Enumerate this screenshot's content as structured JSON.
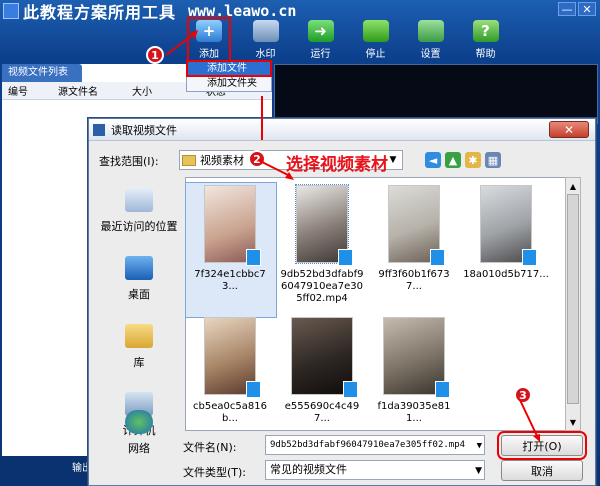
{
  "app": {
    "title": "此教程方案所用工具",
    "site": "www.leawo.cn",
    "window_buttons": [
      "—",
      "✕"
    ]
  },
  "toolbar": {
    "items": [
      {
        "label": "添加",
        "icon": "add-video-icon"
      },
      {
        "label": "水印",
        "icon": "watermark-icon"
      },
      {
        "label": "运行",
        "icon": "run-arrow-icon"
      },
      {
        "label": "停止",
        "icon": "stop-icon"
      },
      {
        "label": "设置",
        "icon": "settings-icon"
      },
      {
        "label": "帮助",
        "icon": "help-icon"
      }
    ]
  },
  "menu": {
    "items": [
      "添加文件",
      "添加文件夹"
    ]
  },
  "left_panel": {
    "tab": "视频文件列表",
    "columns": [
      "编号",
      "源文件名",
      "大小",
      "状态"
    ]
  },
  "bottom_bar": {
    "text": "输出"
  },
  "annotations": {
    "step1": "1",
    "step2": "2",
    "step3": "3",
    "step2_text": "选择视频素材"
  },
  "dialog": {
    "title": "读取视频文件",
    "close": "✕",
    "lookin_label": "查找范围(I):",
    "lookin_value": "视频素材",
    "places": [
      {
        "label": "最近访问的位置",
        "icon": "recent-places-icon"
      },
      {
        "label": "桌面",
        "icon": "desktop-icon"
      },
      {
        "label": "库",
        "icon": "library-icon"
      },
      {
        "label": "计算机",
        "icon": "computer-icon"
      },
      {
        "label": "网络",
        "icon": "network-icon"
      }
    ],
    "files": [
      {
        "name": "7f324e1cbbc73...",
        "color": "#c9a28e"
      },
      {
        "name": "9db52bd3dfabf96047910ea7e305ff02.mp4",
        "color": "#8a7f78"
      },
      {
        "name": "9ff3f60b1f6737...",
        "color": "#b7b2aa"
      },
      {
        "name": "18a010d5b717...",
        "color": "#9fa3a7"
      },
      {
        "name": "cb5ea0c5a816b...",
        "color": "#a88668"
      },
      {
        "name": "e555690c4c497...",
        "color": "#2e2824"
      },
      {
        "name": "f1da39035e811...",
        "color": "#7e7568"
      }
    ],
    "filename_label": "文件名(N):",
    "filename_value": "9db52bd3dfabf96047910ea7e305ff02.mp4",
    "filetype_label": "文件类型(T):",
    "filetype_value": "常见的视频文件",
    "open_button": "打开(O)",
    "cancel_button": "取消"
  }
}
